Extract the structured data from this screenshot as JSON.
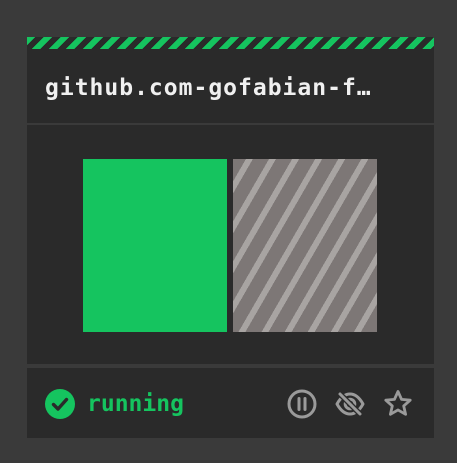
{
  "card": {
    "title": "github.com-gofabian-f…",
    "status": {
      "label": "running",
      "icon": "check-circle-icon",
      "color": "#15c45f"
    },
    "actions": [
      {
        "icon": "pause-icon"
      },
      {
        "icon": "hide-icon"
      },
      {
        "icon": "star-icon"
      }
    ],
    "progress": {
      "segments": [
        {
          "state": "running",
          "fraction": 0.5,
          "color": "#15c45f"
        },
        {
          "state": "striped",
          "fraction": 0.5,
          "color": "#7d7776"
        }
      ]
    }
  }
}
